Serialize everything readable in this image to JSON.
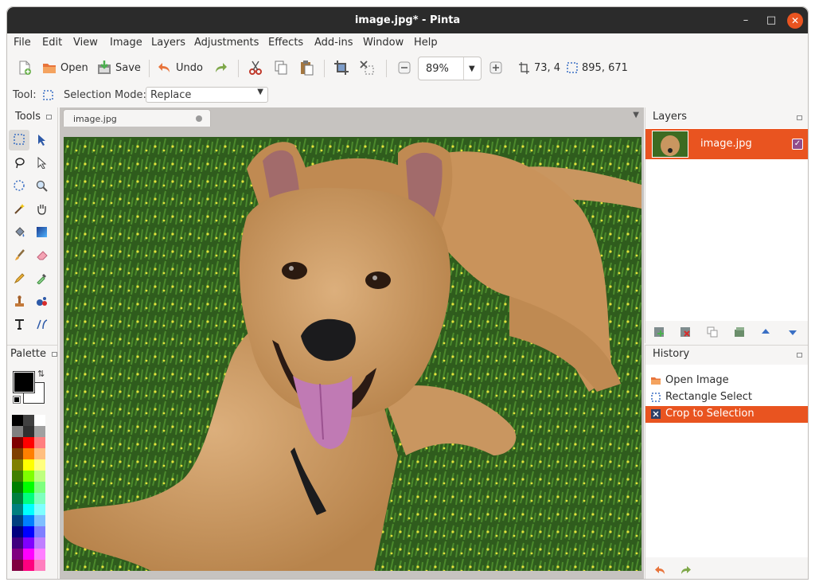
{
  "window": {
    "title": "image.jpg* - Pinta"
  },
  "menu": [
    "File",
    "Edit",
    "View",
    "Image",
    "Layers",
    "Adjustments",
    "Effects",
    "Add-ins",
    "Window",
    "Help"
  ],
  "toolbar": {
    "open_label": "Open",
    "save_label": "Save",
    "undo_label": "Undo",
    "zoom_value": "89%",
    "cursor_position": "73, 4",
    "selection_size": "895, 671"
  },
  "tool_options": {
    "tool_label": "Tool:",
    "selection_mode_label": "Selection Mode:",
    "selection_mode_value": "Replace"
  },
  "tools_panel": {
    "title": "Tools"
  },
  "palette_panel": {
    "title": "Palette",
    "primary_color": "#000000",
    "secondary_color": "#ffffff"
  },
  "document_tab": {
    "label": "image.jpg"
  },
  "layers_panel": {
    "title": "Layers",
    "layers": [
      {
        "name": "image.jpg",
        "visible": true
      }
    ]
  },
  "history_panel": {
    "title": "History",
    "items": [
      {
        "label": "Open Image",
        "selected": false
      },
      {
        "label": "Rectangle Select",
        "selected": false
      },
      {
        "label": "Crop to Selection",
        "selected": true
      }
    ]
  },
  "colors": {
    "accent": "#e95420",
    "titlebar": "#2b2b2b"
  }
}
